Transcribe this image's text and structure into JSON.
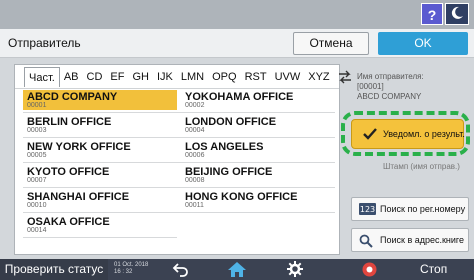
{
  "topbar": {
    "help_label": "?",
    "help_icon": "help-icon",
    "theme_icon": "moon-icon"
  },
  "header": {
    "title": "Отправитель",
    "cancel_label": "Отмена",
    "ok_label": "OK"
  },
  "tabs": [
    {
      "label": "Част.",
      "active": true
    },
    {
      "label": "AB"
    },
    {
      "label": "CD"
    },
    {
      "label": "EF"
    },
    {
      "label": "GH"
    },
    {
      "label": "IJK"
    },
    {
      "label": "LMN"
    },
    {
      "label": "OPQ"
    },
    {
      "label": "RST"
    },
    {
      "label": "UVW"
    },
    {
      "label": "XYZ"
    }
  ],
  "entries": [
    {
      "name": "ABCD COMPANY",
      "number": "00001",
      "selected": true
    },
    {
      "name": "YOKOHAMA OFFICE",
      "number": "00002"
    },
    {
      "name": "BERLIN OFFICE",
      "number": "00003"
    },
    {
      "name": "LONDON OFFICE",
      "number": "00004"
    },
    {
      "name": "NEW YORK OFFICE",
      "number": "00005"
    },
    {
      "name": "LOS ANGELES",
      "number": "00006"
    },
    {
      "name": "KYOTO OFFICE",
      "number": "00007"
    },
    {
      "name": "BEIJING OFFICE",
      "number": "00008"
    },
    {
      "name": "SHANGHAI  OFFICE",
      "number": "00010"
    },
    {
      "name": "HONG KONG OFFICE",
      "number": "00011"
    },
    {
      "name": "OSAKA OFFICE",
      "number": "00014"
    }
  ],
  "sender_info": {
    "label": "Имя отправителя:",
    "number": "[00001]",
    "name": "ABCD COMPANY"
  },
  "buttons": {
    "notify_label": "Уведомл. о результ.",
    "stamp_label": "Штамп (имя отправ.)",
    "search_number_label": "Поиск по рег.номеру",
    "search_number_icon_text": "123",
    "search_book_label": "Поиск в адрес.книге"
  },
  "bottom": {
    "status_label": "Проверить статус",
    "date": "01 Oct. 2018",
    "time": "16 : 32",
    "stop_label": "Стоп"
  },
  "colors": {
    "accent_blue": "#2f9fd6",
    "selected_yellow": "#f2c03b",
    "highlight_green": "#2ab04a",
    "bottom_bar": "#3b4252"
  }
}
